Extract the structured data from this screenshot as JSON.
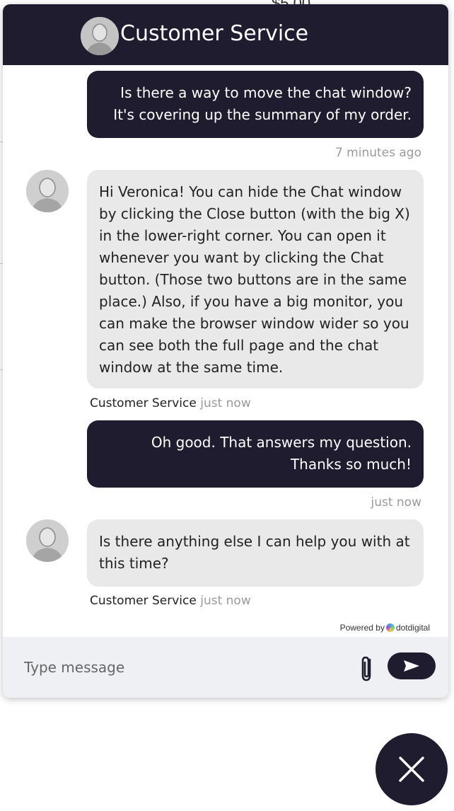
{
  "background": {
    "price_fragment": "$5.00"
  },
  "header": {
    "title": "Customer Service",
    "avatar_icon": "person-avatar-icon"
  },
  "messages": [
    {
      "from": "user",
      "text": "Is there a way to move the chat window? It's covering up the summary of my order.",
      "time": "7 minutes ago"
    },
    {
      "from": "agent",
      "text": "Hi Veronica! You can hide the Chat window by clicking the Close button (with the big X) in the lower-right corner. You can open it whenever you want by clicking the Chat but­ton. (Those two buttons are in the same place.)   Also, if you have a big monitor, you can make the browser window wider so you can see both the full page and the chat win­dow at the same time.",
      "sender": "Customer Service",
      "time": "just now"
    },
    {
      "from": "user",
      "text": "Oh good. That answers my question. Thanks so much!",
      "time": "just now"
    },
    {
      "from": "agent",
      "text": "Is there anything else I can help you with at this time?",
      "sender": "Customer Service",
      "time": "just now"
    }
  ],
  "branding": {
    "powered_by": "Powered by",
    "brand": "dotdigital"
  },
  "composer": {
    "placeholder": "Type message",
    "attach_icon": "paperclip-icon",
    "send_icon": "send-arrow-icon"
  },
  "close_button": {
    "icon": "close-icon"
  },
  "colors": {
    "primary": "#1e1c2e",
    "agent_bubble": "#e9e9e9",
    "composer_bg": "#eef0f3"
  }
}
